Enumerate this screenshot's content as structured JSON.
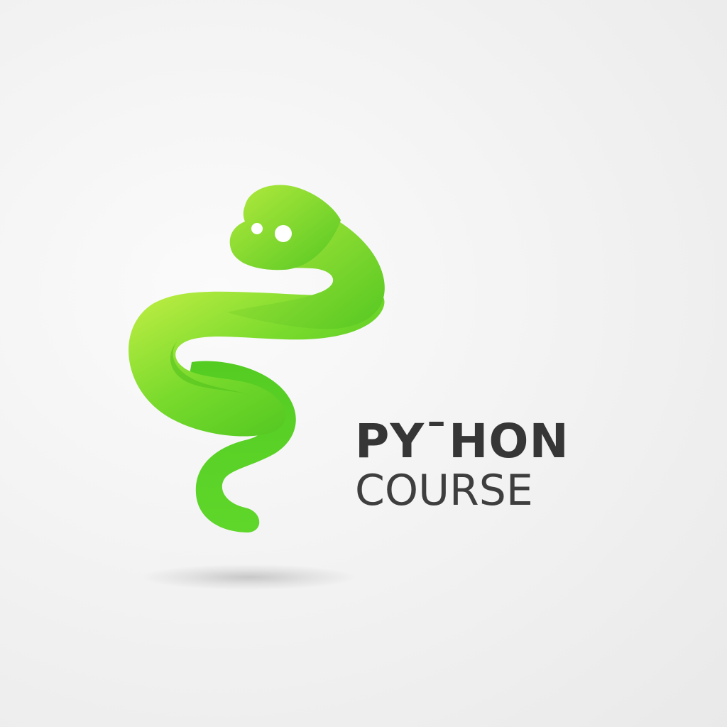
{
  "logo": {
    "icon": "snake-icon",
    "title": "PYˉHON",
    "subtitle": "COURSE",
    "colors": {
      "snake_light": "#b6ea3c",
      "snake_mid": "#6fd82a",
      "snake_dark": "#3fbe1c",
      "text": "#363636",
      "background": "#f2f2f2"
    }
  }
}
